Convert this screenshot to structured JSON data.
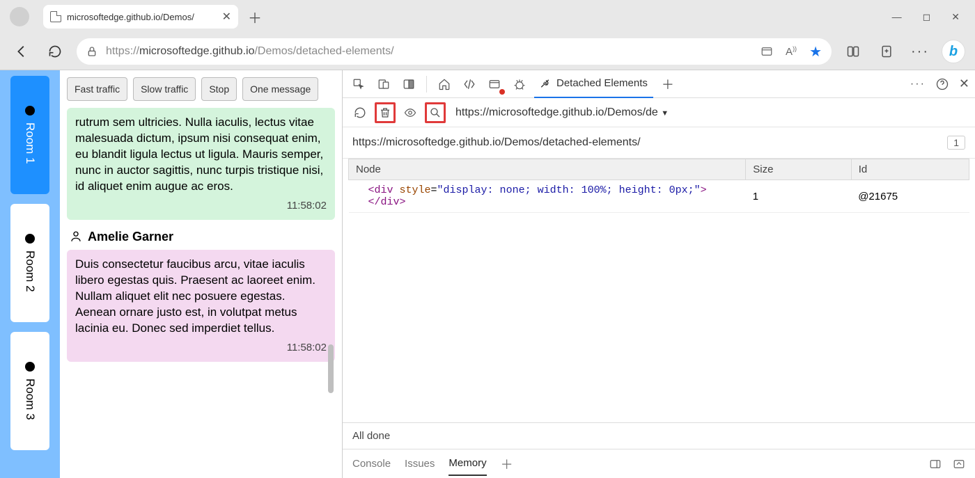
{
  "browser": {
    "tab_title": "microsoftedge.github.io/Demos/",
    "url_prefix": "https://",
    "url_host": "microsoftedge.github.io",
    "url_path": "/Demos/detached-elements/"
  },
  "demo": {
    "rooms": [
      {
        "label": "Room 1",
        "active": true
      },
      {
        "label": "Room 2",
        "active": false
      },
      {
        "label": "Room 3",
        "active": false
      }
    ],
    "controls": {
      "fast": "Fast traffic",
      "slow": "Slow traffic",
      "stop": "Stop",
      "one": "One message"
    },
    "msg1_text": "rutrum sem ultricies. Nulla iaculis, lectus vitae malesuada dictum, ipsum nisi consequat enim, eu blandit ligula lectus ut ligula. Mauris semper, nunc in auctor sagittis, nunc turpis tristique nisi, id aliquet enim augue ac eros.",
    "msg1_time": "11:58:02",
    "sender2": "Amelie Garner",
    "msg2_text": "Duis consectetur faucibus arcu, vitae iaculis libero egestas quis. Praesent ac laoreet enim. Nullam aliquet elit nec posuere egestas. Aenean ornare justo est, in volutpat metus lacinia eu. Donec sed imperdiet tellus.",
    "msg2_time": "11:58:02"
  },
  "devtools": {
    "active_tab": "Detached Elements",
    "frame_selector": "https://microsoftedge.github.io/Demos/de",
    "frame_header": "https://microsoftedge.github.io/Demos/detached-elements/",
    "count_badge": "1",
    "table": {
      "headers": {
        "node": "Node",
        "size": "Size",
        "id": "Id"
      },
      "row": {
        "node_tag_open": "<div",
        "node_attr": " style",
        "node_eq": "=",
        "node_str": "\"display: none; width: 100%; height: 0px;\"",
        "node_close": "></div>",
        "size": "1",
        "id": "@21675"
      }
    },
    "status": "All done",
    "drawer": {
      "console": "Console",
      "issues": "Issues",
      "memory": "Memory"
    }
  }
}
